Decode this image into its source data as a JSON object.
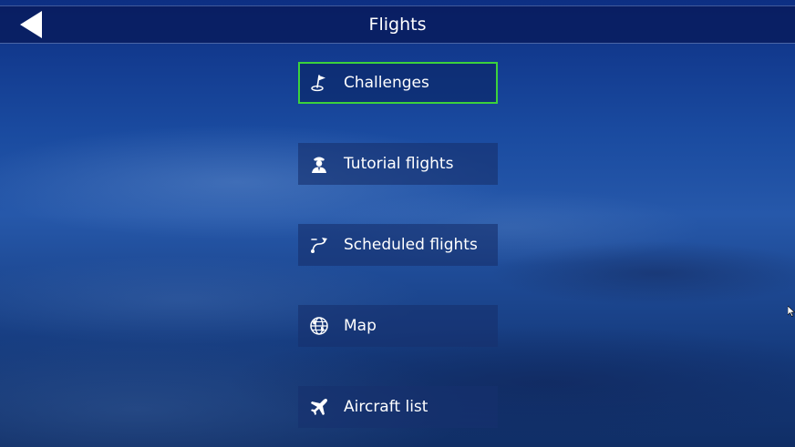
{
  "header": {
    "title": "Flights"
  },
  "menu": {
    "items": [
      {
        "label": "Challenges",
        "icon": "flag-icon",
        "selected": true
      },
      {
        "label": "Tutorial flights",
        "icon": "pilot-icon",
        "selected": false
      },
      {
        "label": "Scheduled flights",
        "icon": "route-icon",
        "selected": false
      },
      {
        "label": "Map",
        "icon": "globe-icon",
        "selected": false
      },
      {
        "label": "Aircraft list",
        "icon": "airplane-icon",
        "selected": false
      }
    ]
  },
  "colors": {
    "selection_border": "#3cd23c",
    "text": "#ffffff",
    "topbar": "#081a5a"
  }
}
